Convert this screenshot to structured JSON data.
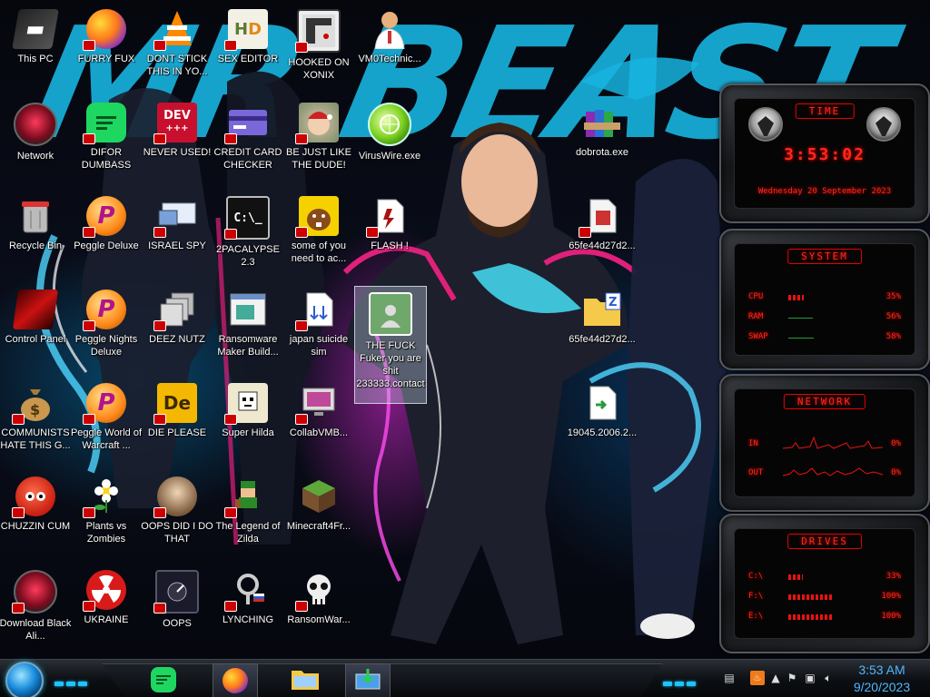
{
  "wallpaper": {
    "text": "MR BEAST"
  },
  "icons": [
    {
      "label": "This PC"
    },
    {
      "label": "FURRY FUX"
    },
    {
      "label": "DONT STICK THIS IN YO..."
    },
    {
      "label": "SEX EDITOR"
    },
    {
      "label": "HOOKED ON XONIX"
    },
    {
      "label": "VM0Technic..."
    },
    {
      "label": "Network"
    },
    {
      "label": "DIFOR DUMBASS"
    },
    {
      "label": "NEVER USED!"
    },
    {
      "label": "CREDIT CARD CHECKER"
    },
    {
      "label": "BE JUST LIKE THE DUDE!"
    },
    {
      "label": "VirusWire.exe"
    },
    {
      "label": "dobrota.exe"
    },
    {
      "label": "Recycle Bin"
    },
    {
      "label": "Peggle Deluxe"
    },
    {
      "label": "ISRAEL SPY"
    },
    {
      "label": "2PACALYPSE 2.3"
    },
    {
      "label": "some of you need to ac..."
    },
    {
      "label": "FLASH !"
    },
    {
      "label": "65fe44d27d2..."
    },
    {
      "label": "Control Panel"
    },
    {
      "label": "Peggle Nights Deluxe"
    },
    {
      "label": "DEEZ NUTZ"
    },
    {
      "label": "Ransomware Maker Build..."
    },
    {
      "label": "japan suicide sim"
    },
    {
      "label": "THE FUCK Fuker you are shit 233333.contact"
    },
    {
      "label": "65fe44d27d2..."
    },
    {
      "label": "COMMUNISTS HATE THIS G..."
    },
    {
      "label": "Peggle World of Warcraft ..."
    },
    {
      "label": "DIE PLEASE"
    },
    {
      "label": "Super Hilda"
    },
    {
      "label": "CollabVMB..."
    },
    {
      "label": "19045.2006.2..."
    },
    {
      "label": "CHUZZIN CUM"
    },
    {
      "label": "Plants vs Zombies"
    },
    {
      "label": "OOPS DID I DO THAT"
    },
    {
      "label": "The Legend of Zilda"
    },
    {
      "label": "Minecraft4Fr..."
    },
    {
      "label": "Download Black Ali..."
    },
    {
      "label": "UKRAINE"
    },
    {
      "label": "OOPS"
    },
    {
      "label": "LYNCHING"
    },
    {
      "label": "RansomWar..."
    }
  ],
  "gadget": {
    "time_title": "TIME",
    "time": "3:53:02",
    "date": "Wednesday 20 September 2023",
    "system_title": "SYSTEM",
    "cpu_label": "CPU",
    "cpu_value": "35%",
    "ram_label": "RAM",
    "ram_value": "56%",
    "swap_label": "SWAP",
    "swap_value": "58%",
    "network_title": "NETWORK",
    "in_label": "IN",
    "in_value": "0%",
    "out_label": "OUT",
    "out_value": "0%",
    "drives_title": "DRIVES",
    "drives": [
      {
        "label": "C:\\",
        "value": "33%"
      },
      {
        "label": "F:\\",
        "value": "100%"
      },
      {
        "label": "E:\\",
        "value": "100%"
      }
    ],
    "levels": {
      "cpu": 0.35,
      "ram": 0.56,
      "swap": 0.58,
      "c": 0.33,
      "f": 1.0,
      "e": 1.0
    }
  },
  "taskbar": {
    "clock_time": "3:53 AM",
    "clock_date": "9/20/2023",
    "pinned": [
      "green-feedback-app-icon",
      "firefox-icon",
      "file-explorer-icon",
      "vm-app-icon"
    ]
  },
  "colors": {
    "accent": "#1ec3ff",
    "gadget_red": "#ff2a1a",
    "clock": "#4fb7ff"
  }
}
